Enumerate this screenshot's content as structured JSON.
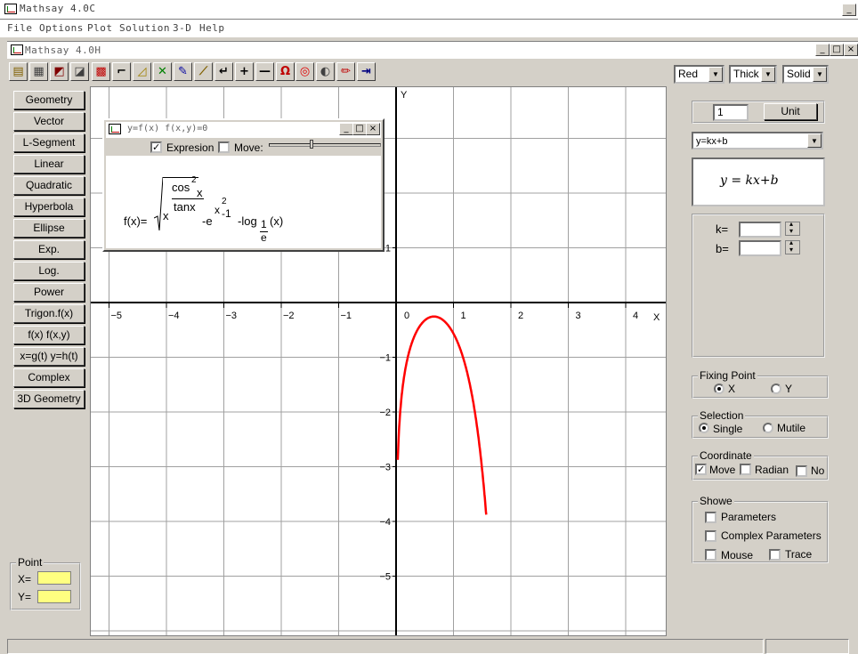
{
  "app": {
    "outer_title": "Mathsay 4.0C",
    "inner_title": "Mathsay 4.0H"
  },
  "menu": [
    "File",
    "Options",
    "Plot",
    "Solution",
    "3-D",
    "Help"
  ],
  "window_controls": {
    "min": "_",
    "max": "□",
    "close": "×"
  },
  "toolbar": [
    {
      "icon": "open-file-icon",
      "glyph": "▤",
      "color": "#806000"
    },
    {
      "icon": "print-icon",
      "glyph": "▦",
      "color": "#404040"
    },
    {
      "icon": "chart-icon",
      "glyph": "◩",
      "color": "#800000"
    },
    {
      "icon": "erase-icon",
      "glyph": "◪",
      "color": "#404040"
    },
    {
      "icon": "grid-icon",
      "glyph": "▩",
      "color": "#c00000"
    },
    {
      "icon": "angle-icon",
      "glyph": "⌐",
      "color": "#000000"
    },
    {
      "icon": "ruler-icon",
      "glyph": "◿",
      "color": "#a08000"
    },
    {
      "icon": "cross-icon",
      "glyph": "✕",
      "color": "#008000"
    },
    {
      "icon": "pen-icon",
      "glyph": "✎",
      "color": "#0000a0"
    },
    {
      "icon": "wand-icon",
      "glyph": "⟋",
      "color": "#806000"
    },
    {
      "icon": "enter-icon",
      "glyph": "↵",
      "color": "#000000"
    },
    {
      "icon": "plus-icon",
      "glyph": "+",
      "color": "#000000"
    },
    {
      "icon": "minus-icon",
      "glyph": "—",
      "color": "#000000"
    },
    {
      "icon": "magnet-icon",
      "glyph": "Ω",
      "color": "#c00000"
    },
    {
      "icon": "target-icon",
      "glyph": "◎",
      "color": "#e00000"
    },
    {
      "icon": "contrast-icon",
      "glyph": "◐",
      "color": "#404040"
    },
    {
      "icon": "pencil-icon",
      "glyph": "✏",
      "color": "#c00000"
    },
    {
      "icon": "export-icon",
      "glyph": "⇥",
      "color": "#000080"
    }
  ],
  "style_selects": {
    "color": "Red",
    "width": "Thick",
    "line": "Solid"
  },
  "sidebar": [
    "Geometry",
    "Vector",
    "L-Segment",
    "Linear",
    "Quadratic",
    "Hyperbola",
    "Ellipse",
    "Exp.",
    "Log.",
    "Power",
    "Trigon.f(x)",
    "f(x)  f(x,y)",
    "x=g(t) y=h(t)",
    "Complex",
    "3D Geometry"
  ],
  "point_panel": {
    "label": "Point",
    "x_label": "X=",
    "y_label": "Y=",
    "field_color": "#ffff80"
  },
  "plot": {
    "x_axis_label": "X",
    "y_axis_label": "Y",
    "curve_color": "#ff0000",
    "x_ticks": [
      {
        "v": -5,
        "label": "−5"
      },
      {
        "v": -4,
        "label": "−4"
      },
      {
        "v": -3,
        "label": "−3"
      },
      {
        "v": -2,
        "label": "−2"
      },
      {
        "v": -1,
        "label": "−1"
      },
      {
        "v": 0,
        "label": "0"
      },
      {
        "v": 1,
        "label": "1"
      },
      {
        "v": 2,
        "label": "2"
      },
      {
        "v": 3,
        "label": "3"
      },
      {
        "v": 4,
        "label": "4"
      }
    ],
    "y_ticks": [
      {
        "v": 1,
        "label": "1"
      },
      {
        "v": -1,
        "label": "−1"
      },
      {
        "v": -2,
        "label": "−2"
      },
      {
        "v": -3,
        "label": "−3"
      },
      {
        "v": -4,
        "label": "−4"
      },
      {
        "v": -5,
        "label": "−5"
      }
    ]
  },
  "function_window": {
    "title": "y=f(x)  f(x,y)=0",
    "expression_label": "Expresion",
    "expression_checked": true,
    "move_label": "Move:",
    "formula": {
      "lhs": "f(x)=",
      "sqrt_x": "x",
      "num": "cos",
      "num_exp": "2",
      "num_tail": "x",
      "den": "tanx",
      "minus_e": "-e",
      "exp": "x",
      "exp_sup": "2",
      "exp_tail": "-1",
      "log": "-log",
      "log_sub_num": "1",
      "log_sub_den": "e",
      "log_arg": "(x)"
    }
  },
  "right_panel": {
    "unit_value": "1",
    "unit_button": "Unit",
    "equation_select": "y=kx+b",
    "formula_display": "y = kx+b",
    "params": [
      {
        "label": "k=",
        "value": ""
      },
      {
        "label": "b=",
        "value": ""
      }
    ],
    "fixing_point": {
      "label": "Fixing Point",
      "options": [
        "X",
        "Y"
      ],
      "selected": "X"
    },
    "selection": {
      "label": "Selection",
      "options": [
        "Single",
        "Mutile"
      ],
      "selected": "Single"
    },
    "coordinate": {
      "label": "Coordinate",
      "options": [
        {
          "label": "Move",
          "checked": true
        },
        {
          "label": "Radian",
          "checked": false
        },
        {
          "label": "No",
          "checked": false
        }
      ]
    },
    "showe": {
      "label": "Showe",
      "options": [
        {
          "label": "Parameters",
          "checked": false
        },
        {
          "label": "Complex Parameters",
          "checked": false
        },
        {
          "label": "Mouse",
          "checked": false
        },
        {
          "label": "Trace",
          "checked": false
        }
      ]
    }
  }
}
